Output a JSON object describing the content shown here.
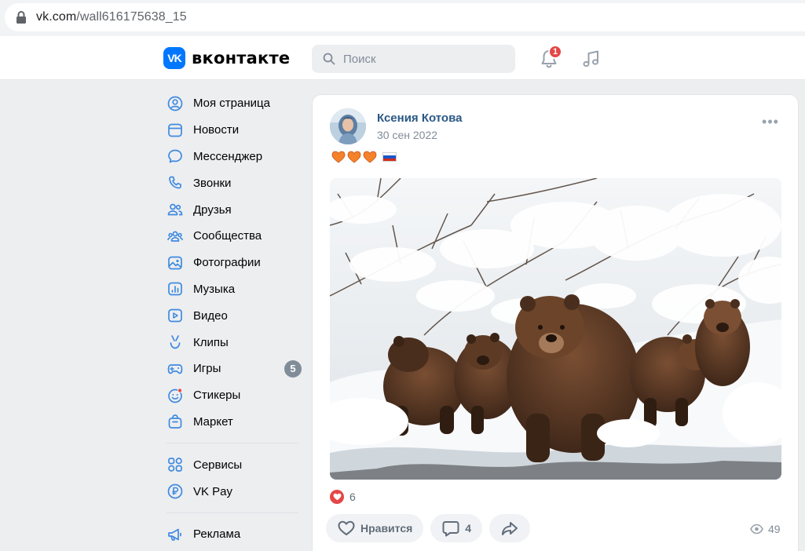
{
  "browser": {
    "url_host": "vk.com",
    "url_path": "/wall616175638_15"
  },
  "header": {
    "logo_badge": "VK",
    "logo_text": "вконтакте",
    "search_placeholder": "Поиск",
    "notifications_count": "1"
  },
  "menu": {
    "items": [
      {
        "label": "Моя страница",
        "icon": "user-circle-icon"
      },
      {
        "label": "Новости",
        "icon": "newsfeed-icon"
      },
      {
        "label": "Мессенджер",
        "icon": "message-icon"
      },
      {
        "label": "Звонки",
        "icon": "phone-icon"
      },
      {
        "label": "Друзья",
        "icon": "friends-icon"
      },
      {
        "label": "Сообщества",
        "icon": "communities-icon"
      },
      {
        "label": "Фотографии",
        "icon": "photo-icon"
      },
      {
        "label": "Музыка",
        "icon": "music-icon"
      },
      {
        "label": "Видео",
        "icon": "video-icon"
      },
      {
        "label": "Клипы",
        "icon": "clips-icon"
      },
      {
        "label": "Игры",
        "icon": "gamepad-icon",
        "count": "5"
      },
      {
        "label": "Стикеры",
        "icon": "sticker-icon"
      },
      {
        "label": "Маркет",
        "icon": "market-icon"
      }
    ],
    "items2": [
      {
        "label": "Сервисы",
        "icon": "services-icon"
      },
      {
        "label": "VK Pay",
        "icon": "vkpay-icon"
      }
    ],
    "items3": [
      {
        "label": "Реклама",
        "icon": "megaphone-icon"
      }
    ]
  },
  "post": {
    "author": "Ксения Котова",
    "date": "30 сен 2022",
    "likes_count": "6",
    "like_label": "Нравится",
    "comments_count": "4",
    "views_count": "49"
  },
  "colors": {
    "accent": "#0077ff",
    "link": "#2a5885",
    "badge_red": "#e64646",
    "menu_icon": "#3f8ae0"
  }
}
